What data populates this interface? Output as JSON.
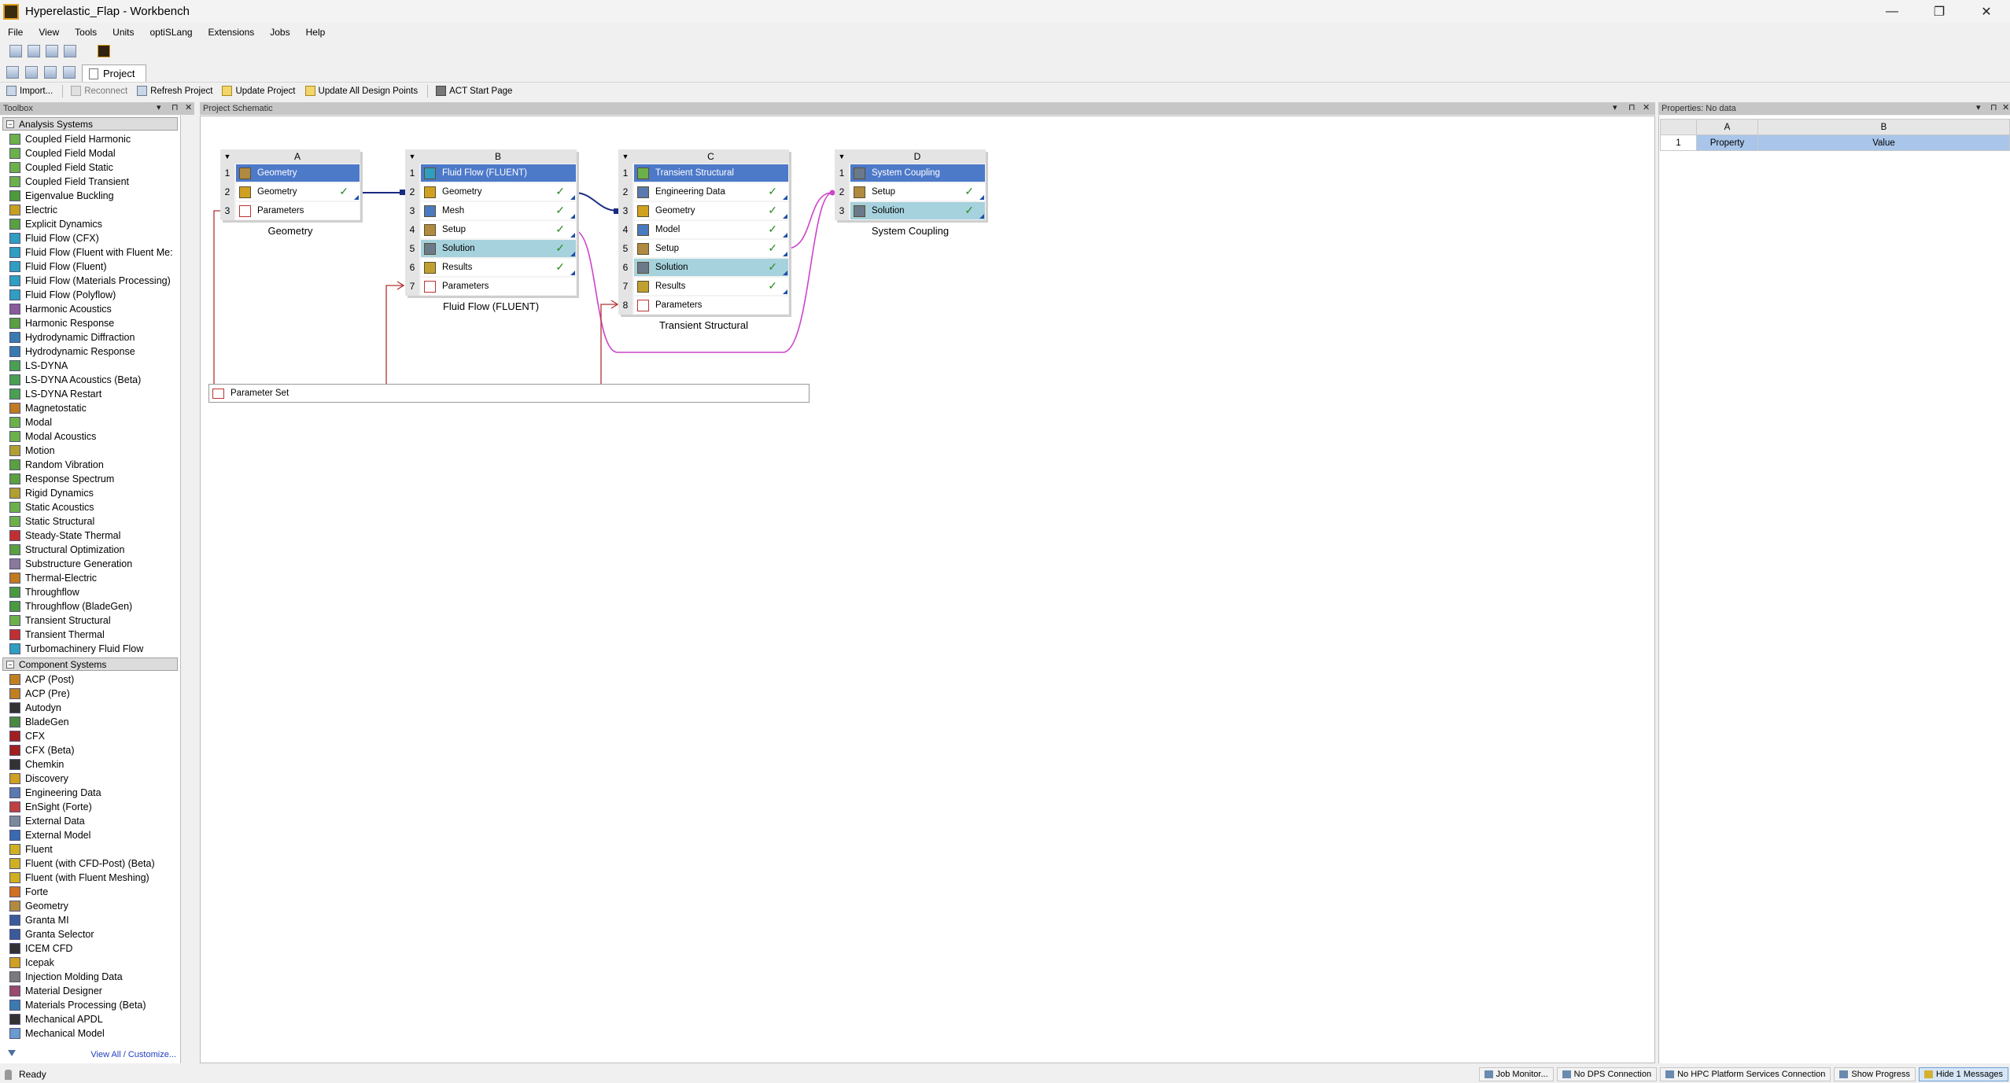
{
  "window": {
    "title": "Hyperelastic_Flap - Workbench",
    "controls": [
      "—",
      "❐",
      "✕"
    ]
  },
  "menu": [
    "File",
    "View",
    "Tools",
    "Units",
    "optiSLang",
    "Extensions",
    "Jobs",
    "Help"
  ],
  "tab": {
    "label": "Project"
  },
  "actions": {
    "import": "Import...",
    "reconnect": "Reconnect",
    "refresh": "Refresh Project",
    "update": "Update Project",
    "update_all": "Update All Design Points",
    "act_start": "ACT Start Page"
  },
  "toolbox": {
    "title": "Toolbox",
    "panel_controls": [
      "▾",
      "⊓",
      "✕"
    ],
    "analysis_title": "Analysis Systems",
    "analysis": [
      {
        "label": "Coupled Field Harmonic",
        "color": "#6cb04a"
      },
      {
        "label": "Coupled Field Modal",
        "color": "#6cb04a"
      },
      {
        "label": "Coupled Field Static",
        "color": "#6cb04a"
      },
      {
        "label": "Coupled Field Transient",
        "color": "#6cb04a"
      },
      {
        "label": "Eigenvalue Buckling",
        "color": "#4d9a3a"
      },
      {
        "label": "Electric",
        "color": "#c8a020"
      },
      {
        "label": "Explicit Dynamics",
        "color": "#5aa040"
      },
      {
        "label": "Fluid Flow (CFX)",
        "color": "#2f9ec0"
      },
      {
        "label": "Fluid Flow (Fluent with Fluent Me:",
        "color": "#2f9ec0"
      },
      {
        "label": "Fluid Flow (Fluent)",
        "color": "#2f9ec0"
      },
      {
        "label": "Fluid Flow (Materials Processing)",
        "color": "#2f9ec0"
      },
      {
        "label": "Fluid Flow (Polyflow)",
        "color": "#2f9ec0"
      },
      {
        "label": "Harmonic Acoustics",
        "color": "#8a5a9a"
      },
      {
        "label": "Harmonic Response",
        "color": "#5aa040"
      },
      {
        "label": "Hydrodynamic Diffraction",
        "color": "#3a7ab0"
      },
      {
        "label": "Hydrodynamic Response",
        "color": "#3a7ab0"
      },
      {
        "label": "LS-DYNA",
        "color": "#4aa050"
      },
      {
        "label": "LS-DYNA Acoustics (Beta)",
        "color": "#4aa050"
      },
      {
        "label": "LS-DYNA Restart",
        "color": "#4aa050"
      },
      {
        "label": "Magnetostatic",
        "color": "#c07a20"
      },
      {
        "label": "Modal",
        "color": "#6cb04a"
      },
      {
        "label": "Modal Acoustics",
        "color": "#6cb04a"
      },
      {
        "label": "Motion",
        "color": "#b0a030"
      },
      {
        "label": "Random Vibration",
        "color": "#5aa040"
      },
      {
        "label": "Response Spectrum",
        "color": "#5aa040"
      },
      {
        "label": "Rigid Dynamics",
        "color": "#b0a030"
      },
      {
        "label": "Static Acoustics",
        "color": "#6cb04a"
      },
      {
        "label": "Static Structural",
        "color": "#6cb04a"
      },
      {
        "label": "Steady-State Thermal",
        "color": "#c03030"
      },
      {
        "label": "Structural Optimization",
        "color": "#5aa040"
      },
      {
        "label": "Substructure Generation",
        "color": "#8a7a9a"
      },
      {
        "label": "Thermal-Electric",
        "color": "#c07a20"
      },
      {
        "label": "Throughflow",
        "color": "#4a9a40"
      },
      {
        "label": "Throughflow (BladeGen)",
        "color": "#4a9a40"
      },
      {
        "label": "Transient Structural",
        "color": "#6cb04a"
      },
      {
        "label": "Transient Thermal",
        "color": "#c03030"
      },
      {
        "label": "Turbomachinery Fluid Flow",
        "color": "#2f9ec0"
      }
    ],
    "component_title": "Component Systems",
    "component": [
      {
        "label": "ACP (Post)",
        "color": "#c08020"
      },
      {
        "label": "ACP (Pre)",
        "color": "#c08020"
      },
      {
        "label": "Autodyn",
        "color": "#333333"
      },
      {
        "label": "BladeGen",
        "color": "#4a8a40"
      },
      {
        "label": "CFX",
        "color": "#a02020"
      },
      {
        "label": "CFX (Beta)",
        "color": "#a02020"
      },
      {
        "label": "Chemkin",
        "color": "#333333"
      },
      {
        "label": "Discovery",
        "color": "#d0a020"
      },
      {
        "label": "Engineering Data",
        "color": "#5a7ab0"
      },
      {
        "label": "EnSight (Forte)",
        "color": "#c04040"
      },
      {
        "label": "External Data",
        "color": "#7a8a9a"
      },
      {
        "label": "External Model",
        "color": "#3a6ab0"
      },
      {
        "label": "Fluent",
        "color": "#d0b020"
      },
      {
        "label": "Fluent (with CFD-Post) (Beta)",
        "color": "#d0b020"
      },
      {
        "label": "Fluent (with Fluent Meshing)",
        "color": "#d0b020"
      },
      {
        "label": "Forte",
        "color": "#d07020"
      },
      {
        "label": "Geometry",
        "color": "#b08a40"
      },
      {
        "label": "Granta MI",
        "color": "#3a5a9a"
      },
      {
        "label": "Granta Selector",
        "color": "#3a5a9a"
      },
      {
        "label": "ICEM CFD",
        "color": "#333333"
      },
      {
        "label": "Icepak",
        "color": "#d0a020"
      },
      {
        "label": "Injection Molding Data",
        "color": "#7a7a7a"
      },
      {
        "label": "Material Designer",
        "color": "#9a4a6a"
      },
      {
        "label": "Materials Processing (Beta)",
        "color": "#3a7ab0"
      },
      {
        "label": "Mechanical APDL",
        "color": "#333333"
      },
      {
        "label": "Mechanical Model",
        "color": "#6a9ad0"
      }
    ],
    "footer_link": "View All / Customize..."
  },
  "schematic": {
    "title": "Project Schematic",
    "panel_controls": [
      "▾",
      "⊓",
      "✕"
    ],
    "systems": [
      {
        "letter": "A",
        "caption": "Geometry",
        "cells": [
          {
            "n": "1",
            "label": "Geometry",
            "kind": "title",
            "color": "#b08a40"
          },
          {
            "n": "2",
            "label": "Geometry",
            "kind": "normal",
            "check": "✓",
            "color": "#d0a020"
          },
          {
            "n": "3",
            "label": "Parameters",
            "kind": "param",
            "color": "#ffffff"
          }
        ]
      },
      {
        "letter": "B",
        "caption": "Fluid Flow (FLUENT)",
        "cells": [
          {
            "n": "1",
            "label": "Fluid Flow (FLUENT)",
            "kind": "title",
            "color": "#2f9ec0"
          },
          {
            "n": "2",
            "label": "Geometry",
            "kind": "normal",
            "check": "✓",
            "color": "#d0a020"
          },
          {
            "n": "3",
            "label": "Mesh",
            "kind": "normal",
            "check": "✓",
            "color": "#4a7ac0"
          },
          {
            "n": "4",
            "label": "Setup",
            "kind": "normal",
            "check": "✓",
            "color": "#b08a40"
          },
          {
            "n": "5",
            "label": "Solution",
            "kind": "sol",
            "check": "✓",
            "color": "#6a7a8a"
          },
          {
            "n": "6",
            "label": "Results",
            "kind": "normal",
            "check": "✓",
            "color": "#c0a030"
          },
          {
            "n": "7",
            "label": "Parameters",
            "kind": "param",
            "color": "#ffffff"
          }
        ]
      },
      {
        "letter": "C",
        "caption": "Transient Structural",
        "cells": [
          {
            "n": "1",
            "label": "Transient Structural",
            "kind": "title",
            "color": "#6cb04a"
          },
          {
            "n": "2",
            "label": "Engineering Data",
            "kind": "normal",
            "check": "✓",
            "color": "#5a7ab0"
          },
          {
            "n": "3",
            "label": "Geometry",
            "kind": "normal",
            "check": "✓",
            "color": "#d0a020"
          },
          {
            "n": "4",
            "label": "Model",
            "kind": "normal",
            "check": "✓",
            "color": "#4a7ac0"
          },
          {
            "n": "5",
            "label": "Setup",
            "kind": "normal",
            "check": "✓",
            "color": "#b08a40"
          },
          {
            "n": "6",
            "label": "Solution",
            "kind": "sol",
            "check": "✓",
            "color": "#6a7a8a"
          },
          {
            "n": "7",
            "label": "Results",
            "kind": "normal",
            "check": "✓",
            "color": "#c0a030"
          },
          {
            "n": "8",
            "label": "Parameters",
            "kind": "param",
            "color": "#ffffff"
          }
        ]
      },
      {
        "letter": "D",
        "caption": "System Coupling",
        "cells": [
          {
            "n": "1",
            "label": "System Coupling",
            "kind": "title",
            "color": "#6a7a8a"
          },
          {
            "n": "2",
            "label": "Setup",
            "kind": "normal",
            "check": "✓",
            "color": "#b08a40"
          },
          {
            "n": "3",
            "label": "Solution",
            "kind": "sol",
            "check": "✓",
            "color": "#6a7a8a"
          }
        ]
      }
    ],
    "parameter_set": "Parameter Set"
  },
  "properties": {
    "title": "Properties: No data",
    "panel_controls": [
      "▾",
      "⊓",
      "✕"
    ],
    "col_a": "A",
    "col_b": "B",
    "row_num": "1",
    "property": "Property",
    "value": "Value"
  },
  "status": {
    "ready": "Ready",
    "buttons": [
      "Job Monitor...",
      "No DPS Connection",
      "No HPC Platform Services Connection",
      "Show Progress",
      "Hide 1 Messages"
    ]
  }
}
